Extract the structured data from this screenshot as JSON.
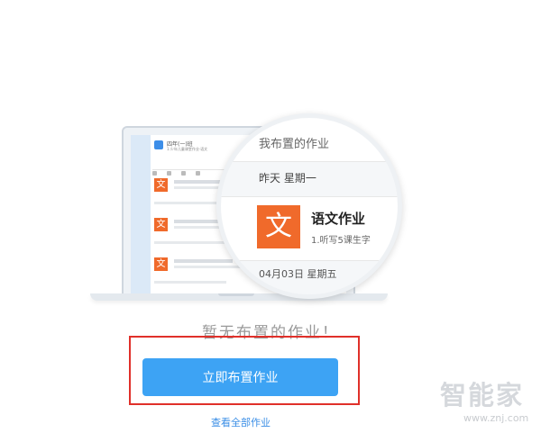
{
  "illustration": {
    "mini_window": {
      "title": "四年(一)班",
      "subtitle": "1.少年儿童课堂作业·语文"
    },
    "magnified": {
      "title": "我布置的作业",
      "day_label": "昨天  星期一",
      "icon_char": "文",
      "homework_title": "语文作业",
      "homework_desc": "1.听写5课生字",
      "date_label": "04月03日  星期五"
    }
  },
  "empty_state": {
    "message": "暂无布置的作业！"
  },
  "actions": {
    "primary_button_label": "立即布置作业",
    "view_all_label": "查看全部作业"
  },
  "watermark": {
    "brand": "智能家",
    "url": "www.znj.com"
  },
  "colors": {
    "accent": "#3da3f4",
    "subject_orange": "#f06a2b",
    "highlight_red": "#e0302a",
    "link_blue": "#3a8ee6"
  }
}
